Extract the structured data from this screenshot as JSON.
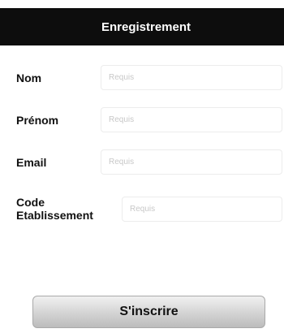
{
  "navbar": {
    "title": "Enregistrement"
  },
  "form": {
    "fields": [
      {
        "label": "Nom",
        "placeholder": "Requis",
        "value": ""
      },
      {
        "label": "Prénom",
        "placeholder": "Requis",
        "value": ""
      },
      {
        "label": "Email",
        "placeholder": "Requis",
        "value": ""
      },
      {
        "label_line1": "Code",
        "label_line2": "Etablissement",
        "placeholder": "Requis",
        "value": ""
      }
    ]
  },
  "submit": {
    "label": "S'inscrire"
  },
  "colors": {
    "navbar_bg": "#0d0d0d",
    "button_top": "#f1f1f1",
    "button_bottom": "#bcbcbc"
  }
}
